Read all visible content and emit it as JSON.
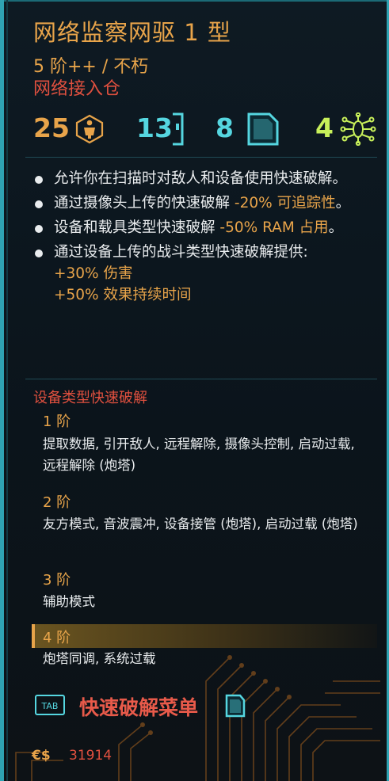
{
  "item": {
    "name": "网络监察网驱 1 型",
    "tier": "5 阶++ / 不朽",
    "slot": "网络接入仓"
  },
  "stats": [
    {
      "value": "25",
      "icon": "humanoid-icon",
      "color": "#e8a44a"
    },
    {
      "value": "13",
      "icon": "ram-slot-icon",
      "color": "#55d6e0"
    },
    {
      "value": "8",
      "icon": "memory-card-icon",
      "color": "#55d6e0"
    },
    {
      "value": "4",
      "icon": "neural-chip-icon",
      "color": "#c8f05a"
    }
  ],
  "effects": [
    {
      "text": "允许你在扫描时对敌人和设备使用快速破解。",
      "hl": ""
    },
    {
      "text": "通过摄像头上传的快速破解 ",
      "hl": "-20% 可追踪性",
      "tail": "。"
    },
    {
      "text": "设备和载具类型快速破解 ",
      "hl": "-50% RAM 占用",
      "tail": "。"
    },
    {
      "text": "通过设备上传的战斗类型快速破解提供:",
      "hl": "+30% 伤害",
      "hl2": "+50% 效果持续时间"
    }
  ],
  "device_hacks": {
    "title": "设备类型快速破解",
    "levels": [
      {
        "label": "1 阶",
        "desc": "提取数据, 引开敌人, 远程解除, 摄像头控制, 启动过载, 远程解除 (炮塔)"
      },
      {
        "label": "2 阶",
        "desc": "友方模式, 音波震冲, 设备接管 (炮塔), 启动过载 (炮塔)"
      },
      {
        "label": "3 阶",
        "desc": "辅助模式"
      },
      {
        "label": "4 阶",
        "desc": "炮塔同调, 系统过载",
        "active": true
      }
    ]
  },
  "footer": {
    "tab_key": "TAB",
    "menu_label": "快速破解菜单",
    "currency_symbol": "€$",
    "money": "31914"
  },
  "colors": {
    "accent": "#e8a44a",
    "red": "#e0503f",
    "cyan": "#55d6e0",
    "green": "#c8f05a"
  }
}
